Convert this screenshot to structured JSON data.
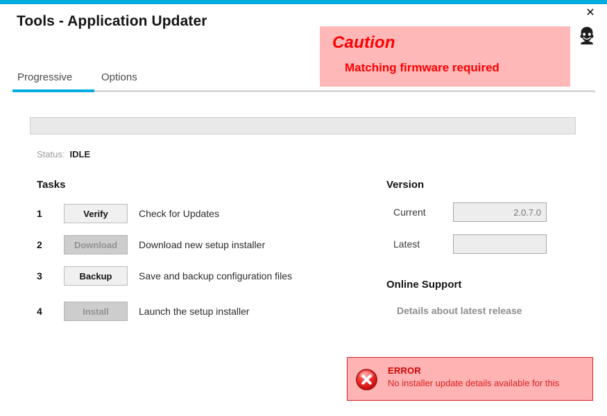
{
  "window": {
    "title": "Tools - Application Updater",
    "close_label": "✕",
    "accent_color": "#00ACDD"
  },
  "support_icon": {
    "name": "headset-support-icon"
  },
  "caution": {
    "title": "Caution",
    "message": "Matching firmware required",
    "background": "#FFB8B8",
    "text_color": "#FF0000"
  },
  "tabs": [
    {
      "label": "Progressive",
      "active": true
    },
    {
      "label": "Options",
      "active": false
    }
  ],
  "progress": {
    "percent": 0
  },
  "status": {
    "label": "Status:",
    "value": "IDLE"
  },
  "tasks": {
    "heading": "Tasks",
    "rows": [
      {
        "index": "1",
        "button": "Verify",
        "enabled": true,
        "description": "Check for Updates"
      },
      {
        "index": "2",
        "button": "Download",
        "enabled": false,
        "description": "Download new setup installer"
      },
      {
        "index": "3",
        "button": "Backup",
        "enabled": true,
        "description": "Save and backup configuration files"
      },
      {
        "index": "4",
        "button": "Install",
        "enabled": false,
        "description": "Launch the setup installer"
      }
    ]
  },
  "version": {
    "heading": "Version",
    "fields": [
      {
        "label": "Current",
        "value": "2.0.7.0",
        "placeholder": ""
      },
      {
        "label": "Latest",
        "value": "",
        "placeholder": ""
      }
    ]
  },
  "online_support": {
    "heading": "Online Support",
    "link": "Details about latest release"
  },
  "error": {
    "title": "ERROR",
    "message": "No installer update details available for this",
    "background": "#FFB3B3",
    "border_color": "#E02020",
    "icon": "error-circle-x-icon"
  }
}
